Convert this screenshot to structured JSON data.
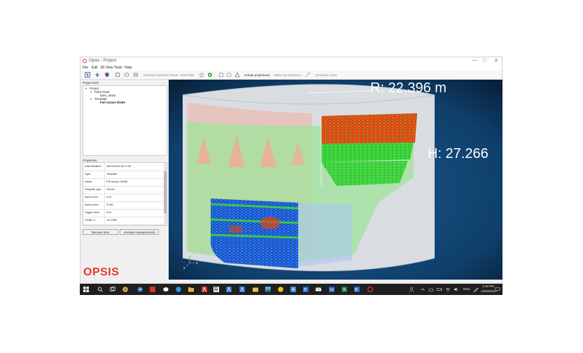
{
  "window": {
    "title": "Opsis - Project",
    "controls": [
      "—",
      "□",
      "✕"
    ]
  },
  "menu": [
    "File",
    "Edit",
    "3D View",
    "Tools",
    "Help"
  ],
  "toolbar": {
    "remove_points": "Remove Selected Points",
    "sos_filter": "SOS Filter",
    "create_projections": "Create projections",
    "select_reference": "Select as reference",
    "deviation_chart": "Deviation chart"
  },
  "project_tree": {
    "header": "Project tree",
    "items": [
      "Project",
      "Point cloud",
      "Dam_v8.laz",
      "Template",
      "Full surace 90x60"
    ]
  },
  "properties": {
    "header": "Properties",
    "rows": [
      {
        "key": "Date Modified",
        "value": "25/01/2019 16:27:25"
      },
      {
        "key": "Type",
        "value": "Template"
      },
      {
        "key": "Name",
        "value": "Full surace 90x60"
      },
      {
        "key": "Template type",
        "value": "Tunnel"
      },
      {
        "key": "Alarm level",
        "value": "0.02"
      },
      {
        "key": "Action level",
        "value": "0.035"
      },
      {
        "key": "Trigger level",
        "value": "0.01"
      },
      {
        "key": "Center X",
        "value": "-40.0309"
      }
    ]
  },
  "buttons": {
    "remove_item": "Remove Item",
    "animate": "Animate measurements"
  },
  "brand": "OPSIS",
  "viewport": {
    "radius_label": "R: 22.396 m",
    "height_label": "H: 27.266",
    "axes": {
      "x": "x",
      "y": "y",
      "z": "z"
    },
    "colors": {
      "background": "#0d2a4a",
      "low": "#1e56d6",
      "mid": "#2ecc2e",
      "high": "#e04a1a"
    }
  },
  "taskbar": {
    "icons": [
      "windows-start-icon",
      "search-icon",
      "task-view-icon",
      "chrome-icon",
      "edge-icon",
      "acrobat-icon",
      "messaging-icon",
      "skype-icon",
      "folder-icon",
      "viewer-a-icon",
      "viewer-r-icon",
      "viewer-a2-icon",
      "viewer-a3-icon",
      "files-icon",
      "image-icon",
      "sticky-icon",
      "download-icon",
      "outlook-icon",
      "mail-icon",
      "word-icon",
      "excel-icon",
      "outlook2-icon",
      "opera-icon"
    ],
    "lang": "ENG",
    "time": "4:29 PM",
    "date": "1/25/2019"
  }
}
